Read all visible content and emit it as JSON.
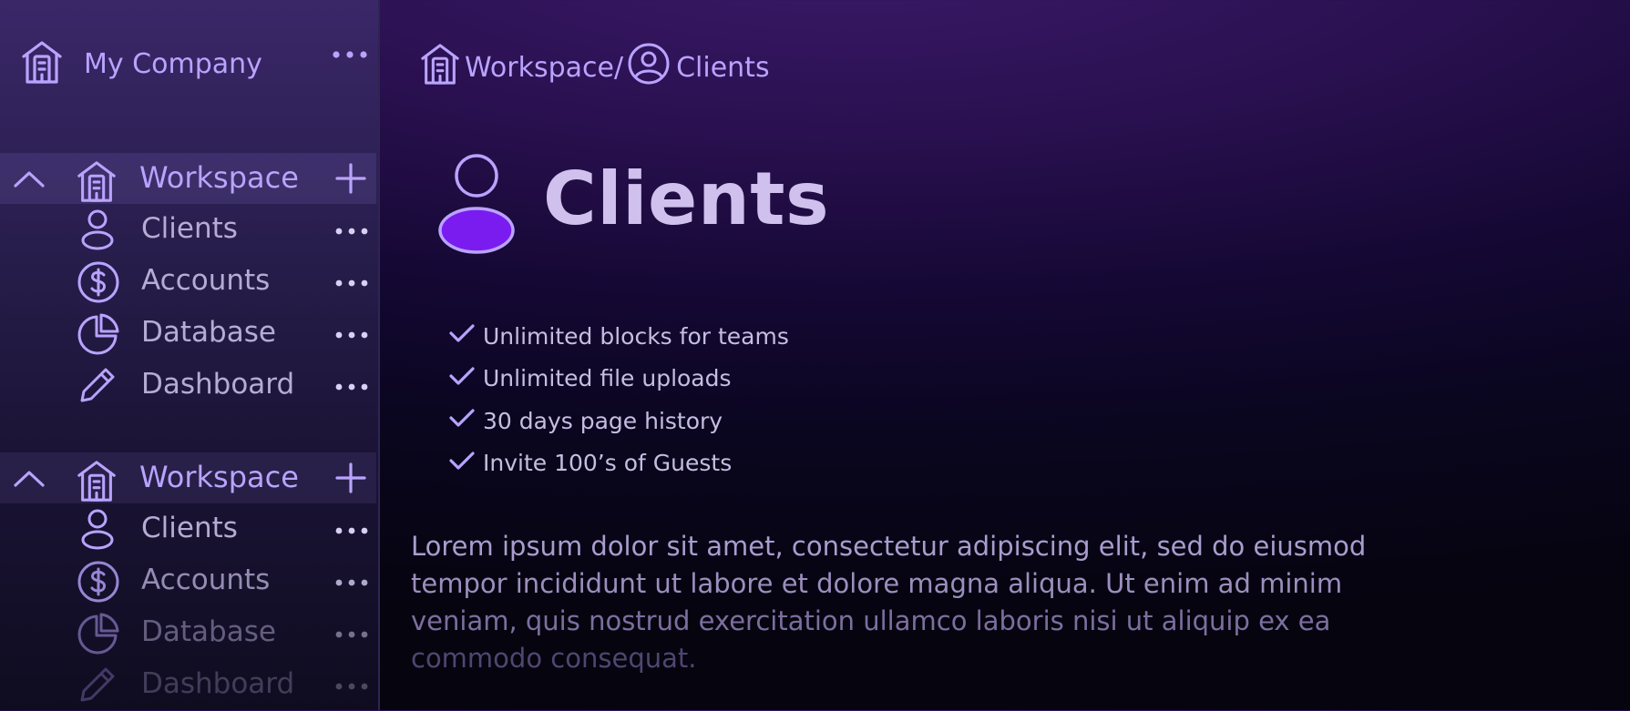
{
  "sidebar": {
    "brand": {
      "title": "My Company",
      "icon": "building-icon",
      "more_icon": "more-icon"
    },
    "sections": [
      {
        "label": "Workspace",
        "items": [
          {
            "label": "Clients",
            "icon": "user-icon"
          },
          {
            "label": "Accounts",
            "icon": "dollar-icon"
          },
          {
            "label": "Database",
            "icon": "pie-chart-icon"
          },
          {
            "label": "Dashboard",
            "icon": "pencil-icon"
          }
        ]
      },
      {
        "label": "Workspace",
        "items": [
          {
            "label": "Clients",
            "icon": "user-icon"
          },
          {
            "label": "Accounts",
            "icon": "dollar-icon"
          },
          {
            "label": "Database",
            "icon": "pie-chart-icon"
          },
          {
            "label": "Dashboard",
            "icon": "pencil-icon"
          }
        ]
      }
    ]
  },
  "breadcrumb": {
    "workspace": "Workspace/",
    "current": "Clients"
  },
  "page": {
    "title": "Clients",
    "features": [
      "Unlimited blocks for teams",
      "Unlimited file uploads",
      "30 days page history",
      "Invite 100’s of Guests"
    ],
    "body_lines": [
      "Lorem ipsum dolor sit amet, consectetur adipiscing elit, sed do eiusmod",
      "tempor incididunt ut labore et dolore magna aliqua. Ut enim ad minim",
      "veniam, quis nostrud exercitation ullamco laboris nisi ut aliquip ex ea",
      "commodo consequat."
    ]
  },
  "colors": {
    "accent": "#b9a3ff",
    "avatar_fill": "#7a1cf0"
  }
}
